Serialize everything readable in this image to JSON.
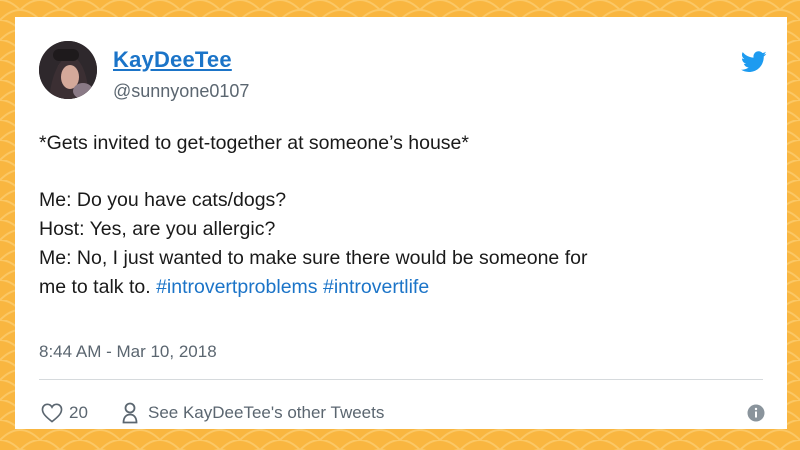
{
  "colors": {
    "background": "#f9b640",
    "card": "#ffffff",
    "link": "#1b74c8",
    "muted": "#5b6670",
    "twitter_blue": "#1d9bf0"
  },
  "tweet": {
    "display_name": "KayDeeTee",
    "handle": "@sunnyone0107",
    "lines": [
      "*Gets invited to get-together at someone’s house*",
      "Me: Do you have cats/dogs?",
      "Host: Yes, are you allergic?",
      "Me: No, I just wanted to make sure there would be someone for",
      "me to talk to."
    ],
    "hashtags": [
      "#introvertproblems",
      "#introvertlife"
    ],
    "timestamp": "8:44 AM - Mar 10, 2018",
    "likes": "20",
    "other_tweets_label": "See KayDeeTee's other Tweets"
  },
  "icons": {
    "logo": "twitter-bird-icon",
    "like": "heart-icon",
    "profile": "person-icon",
    "info": "info-icon"
  }
}
